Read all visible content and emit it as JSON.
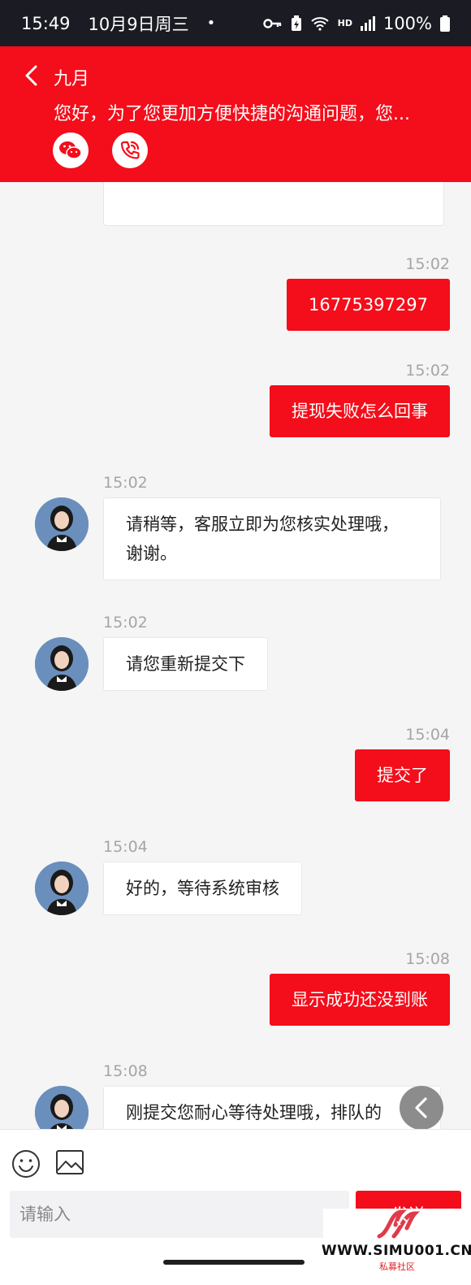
{
  "status_bar": {
    "time": "15:49",
    "date": "10月9日周三",
    "dot": "•",
    "network": "HD",
    "battery": "100%"
  },
  "header": {
    "title": "九月",
    "subtitle": "您好，为了您更加方便快捷的沟通问题，您...",
    "wechat_icon": "wechat-icon",
    "phone_icon": "phone-icon"
  },
  "messages": [
    {
      "side": "out",
      "time": "15:02",
      "text": "16775397297"
    },
    {
      "side": "out",
      "time": "15:02",
      "text": "提现失败怎么回事"
    },
    {
      "side": "in",
      "time": "15:02",
      "line1": "请稍等，客服立即为您核实处理哦，",
      "line2": "谢谢。"
    },
    {
      "side": "in",
      "time": "15:02",
      "text": "请您重新提交下"
    },
    {
      "side": "out",
      "time": "15:04",
      "text": "提交了"
    },
    {
      "side": "in",
      "time": "15:04",
      "text": "好的，等待系统审核"
    },
    {
      "side": "out",
      "time": "15:08",
      "text": "显示成功还没到账"
    },
    {
      "side": "in",
      "time": "15:08",
      "text": "刚提交您耐心等待处理哦，排队的"
    }
  ],
  "input": {
    "placeholder": "请输入",
    "send_label": "发送"
  },
  "watermark": {
    "text": "WWW.SIMU001.CN",
    "sub": "私募社区"
  },
  "colors": {
    "accent": "#f40d1a",
    "status_bar": "#1b1b24",
    "background": "#f5f5f5"
  }
}
